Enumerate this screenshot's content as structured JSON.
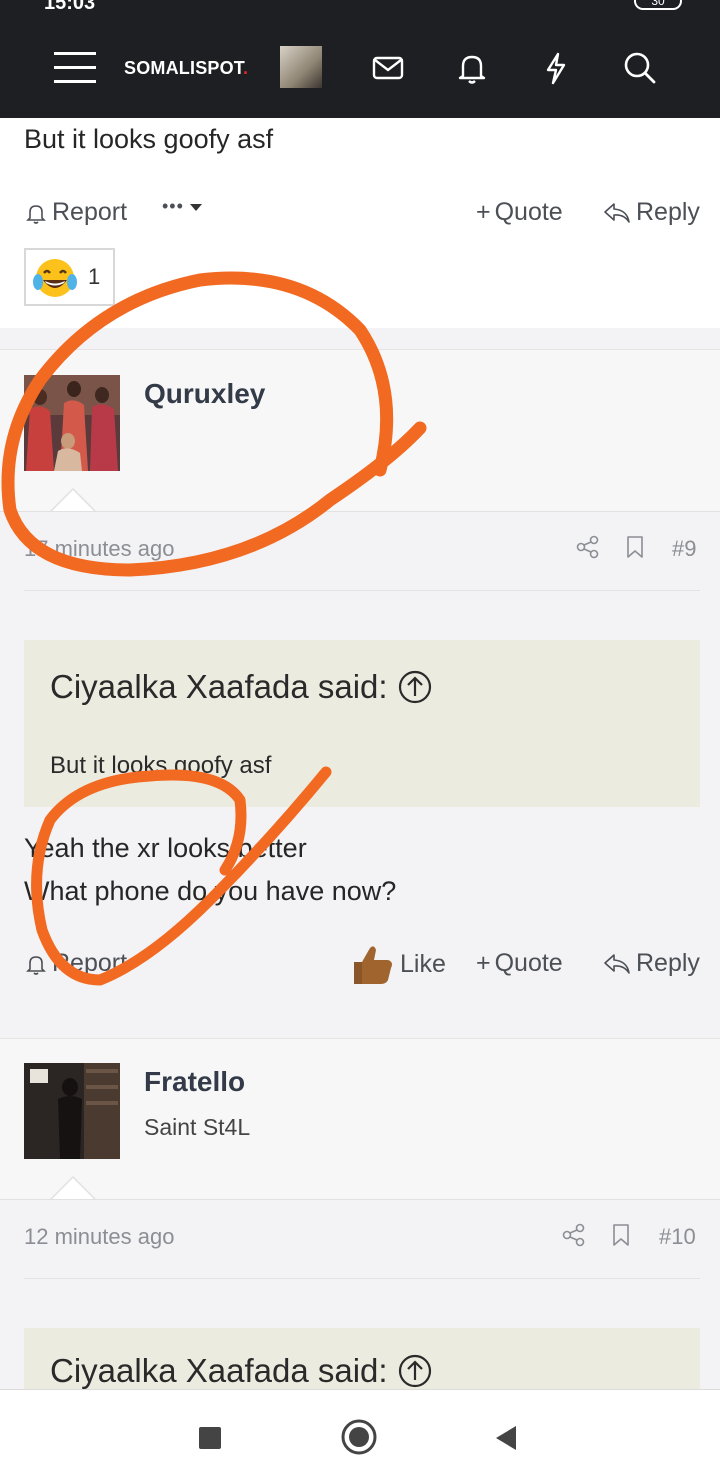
{
  "status": {
    "time": "15:03",
    "battery": "30"
  },
  "header": {
    "site_name": "SOMALISPOT",
    "site_name_dot": ".",
    "icons": [
      "menu-icon",
      "mail-icon",
      "bell-icon",
      "lightning-icon",
      "search-icon"
    ]
  },
  "post8": {
    "text": "But it looks goofy asf",
    "report_label": "Report",
    "more_label": "•••",
    "quote_label": "Quote",
    "reply_label": "Reply",
    "reaction_count": "1"
  },
  "post9": {
    "username": "Quruxley",
    "time": "17 minutes ago",
    "number": "#9",
    "quote_author": "Ciyaalka Xaafada said:",
    "quote_text": "But it looks goofy asf",
    "body_line1": "Yeah the xr looks better",
    "body_line2": "What phone do you have now?",
    "report_label": "Report",
    "like_label": "Like",
    "quote_label": "Quote",
    "reply_label": "Reply"
  },
  "post10": {
    "username": "Fratello",
    "user_title": "Saint St4L",
    "time": "12 minutes ago",
    "number": "#10",
    "quote_author": "Ciyaalka Xaafada said:"
  },
  "colors": {
    "topbar": "#1e1f22",
    "annotation": "#f26a21",
    "quote_bg": "#ecebe0"
  }
}
